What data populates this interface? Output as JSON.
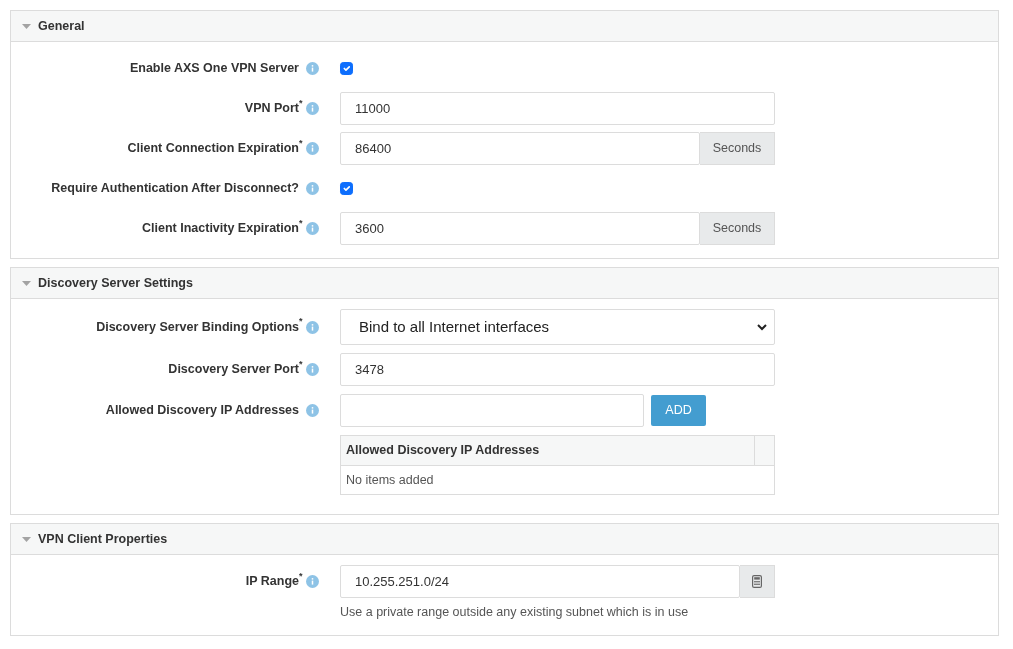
{
  "sections": [
    {
      "title": "General",
      "expanded": true,
      "fields": [
        {
          "kind": "checkbox",
          "label": "Enable AXS One VPN Server",
          "checked": true
        },
        {
          "kind": "text",
          "label": "VPN Port",
          "required_mark": "*",
          "value": "11000"
        },
        {
          "kind": "text",
          "label": "Client Connection Expiration",
          "required_mark": "*",
          "value": "86400",
          "unit": "Seconds"
        },
        {
          "kind": "checkbox",
          "label": "Require Authentication After Disconnect?",
          "checked": true
        },
        {
          "kind": "text",
          "label": "Client Inactivity Expiration",
          "required_mark": "*",
          "value": "3600",
          "unit": "Seconds"
        }
      ]
    },
    {
      "title": "Discovery Server Settings",
      "expanded": true,
      "fields": [
        {
          "kind": "select",
          "label": "Discovery Server Binding Options",
          "required_mark": "*",
          "value": "Bind to all Internet interfaces"
        },
        {
          "kind": "text",
          "label": "Discovery Server Port",
          "required_mark": "*",
          "value": "3478"
        },
        {
          "kind": "list",
          "label": "Allowed Discovery IP Addresses",
          "button": "ADD",
          "table": {
            "columns": [
              "Allowed Discovery IP Addresses"
            ],
            "empty_text": "No items added"
          }
        }
      ]
    },
    {
      "title": "VPN Client Properties",
      "expanded": true,
      "fields": [
        {
          "kind": "text_tool",
          "label": "IP Range",
          "required_mark": "*",
          "value": "10.255.251.0/24",
          "help": "Use a private range outside any existing subnet which is in use"
        }
      ]
    }
  ]
}
